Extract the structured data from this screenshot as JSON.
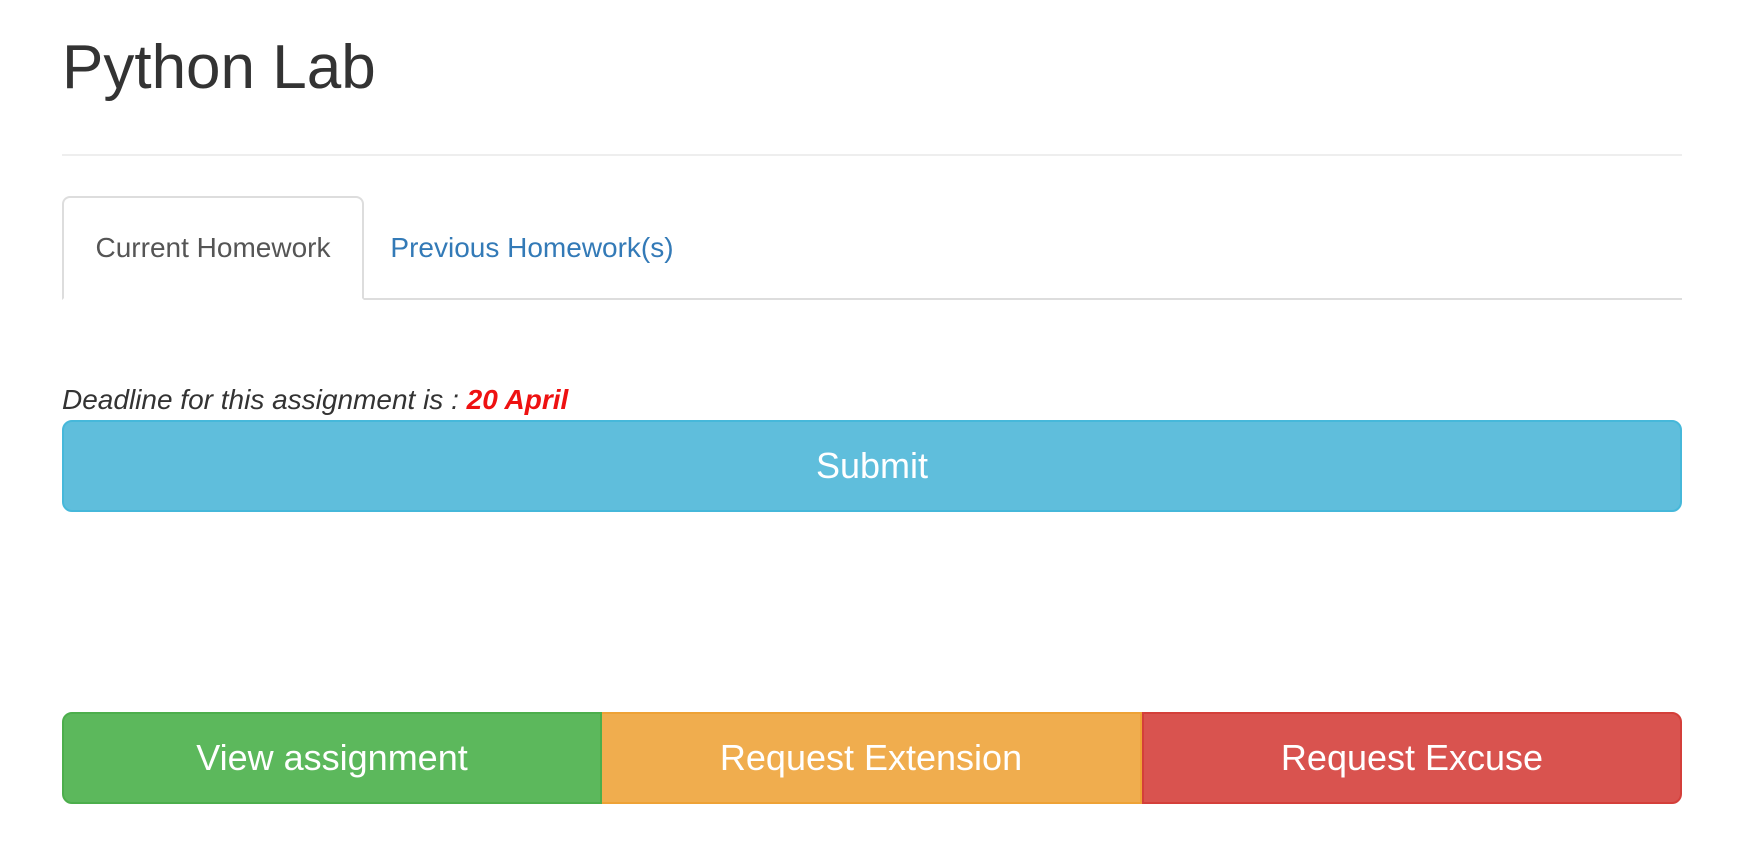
{
  "page": {
    "title": "Python Lab"
  },
  "tabs": [
    {
      "label": "Current Homework",
      "active": true
    },
    {
      "label": "Previous Homework(s)",
      "active": false
    }
  ],
  "deadline": {
    "text": "Deadline for this assignment is :",
    "date": "20 April"
  },
  "actions": {
    "submit_label": "Submit",
    "view_label": "View assignment",
    "extension_label": "Request Extension",
    "excuse_label": "Request Excuse"
  },
  "colors": {
    "submit": "#5fbedc",
    "view": "#5cb85c",
    "extension": "#f0ad4e",
    "excuse": "#d9534f",
    "link": "#337ab7",
    "deadline_date": "#ee1111"
  }
}
